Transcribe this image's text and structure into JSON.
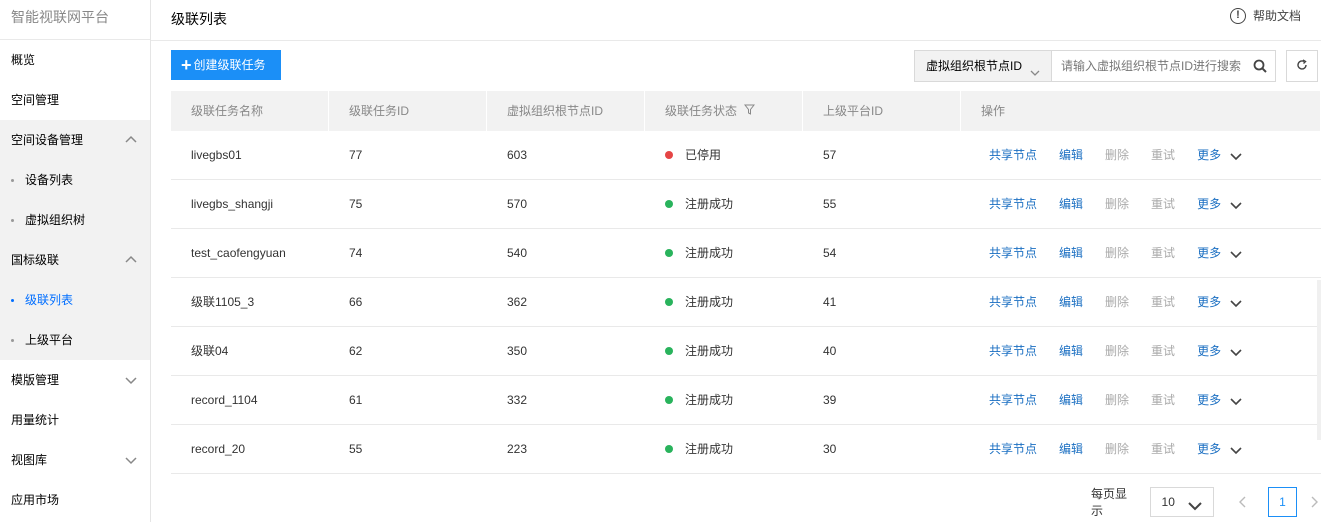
{
  "app": {
    "title": "智能视联网平台"
  },
  "sidebar": {
    "items": [
      {
        "label": "概览"
      },
      {
        "label": "空间管理"
      },
      {
        "label": "空间设备管理"
      },
      {
        "label": "设备列表"
      },
      {
        "label": "虚拟组织树"
      },
      {
        "label": "国标级联"
      },
      {
        "label": "级联列表"
      },
      {
        "label": "上级平台"
      },
      {
        "label": "模版管理"
      },
      {
        "label": "用量统计"
      },
      {
        "label": "视图库"
      },
      {
        "label": "应用市场"
      }
    ]
  },
  "header": {
    "title": "级联列表",
    "help_label": "帮助文档"
  },
  "toolbar": {
    "create_label": "创建级联任务",
    "search_select": "虚拟组织根节点ID",
    "search_placeholder": "请输入虚拟组织根节点ID进行搜索"
  },
  "table": {
    "headers": [
      "级联任务名称",
      "级联任务ID",
      "虚拟组织根节点ID",
      "级联任务状态",
      "上级平台ID",
      "操作"
    ],
    "ops": [
      "共享节点",
      "编辑",
      "删除",
      "重试",
      "更多"
    ],
    "rows": [
      {
        "name": "livegbs01",
        "id": "77",
        "root": "603",
        "status": "已停用",
        "status_color": "#e54545",
        "platform": "57"
      },
      {
        "name": "livegbs_shangji",
        "id": "75",
        "root": "570",
        "status": "注册成功",
        "status_color": "#29b35c",
        "platform": "55"
      },
      {
        "name": "test_caofengyuan",
        "id": "74",
        "root": "540",
        "status": "注册成功",
        "status_color": "#29b35c",
        "platform": "54"
      },
      {
        "name": "级联1105_3",
        "id": "66",
        "root": "362",
        "status": "注册成功",
        "status_color": "#29b35c",
        "platform": "41"
      },
      {
        "name": "级联04",
        "id": "62",
        "root": "350",
        "status": "注册成功",
        "status_color": "#29b35c",
        "platform": "40"
      },
      {
        "name": "record_1104",
        "id": "61",
        "root": "332",
        "status": "注册成功",
        "status_color": "#29b35c",
        "platform": "39"
      },
      {
        "name": "record_20",
        "id": "55",
        "root": "223",
        "status": "注册成功",
        "status_color": "#29b35c",
        "platform": "30"
      }
    ]
  },
  "pagination": {
    "page_size_label": "每页显示",
    "page_size": "10",
    "current_page": "1"
  },
  "colors": {
    "accent": "#1b8ff7",
    "link": "#1b6fc2",
    "active_nav": "#006eff"
  }
}
